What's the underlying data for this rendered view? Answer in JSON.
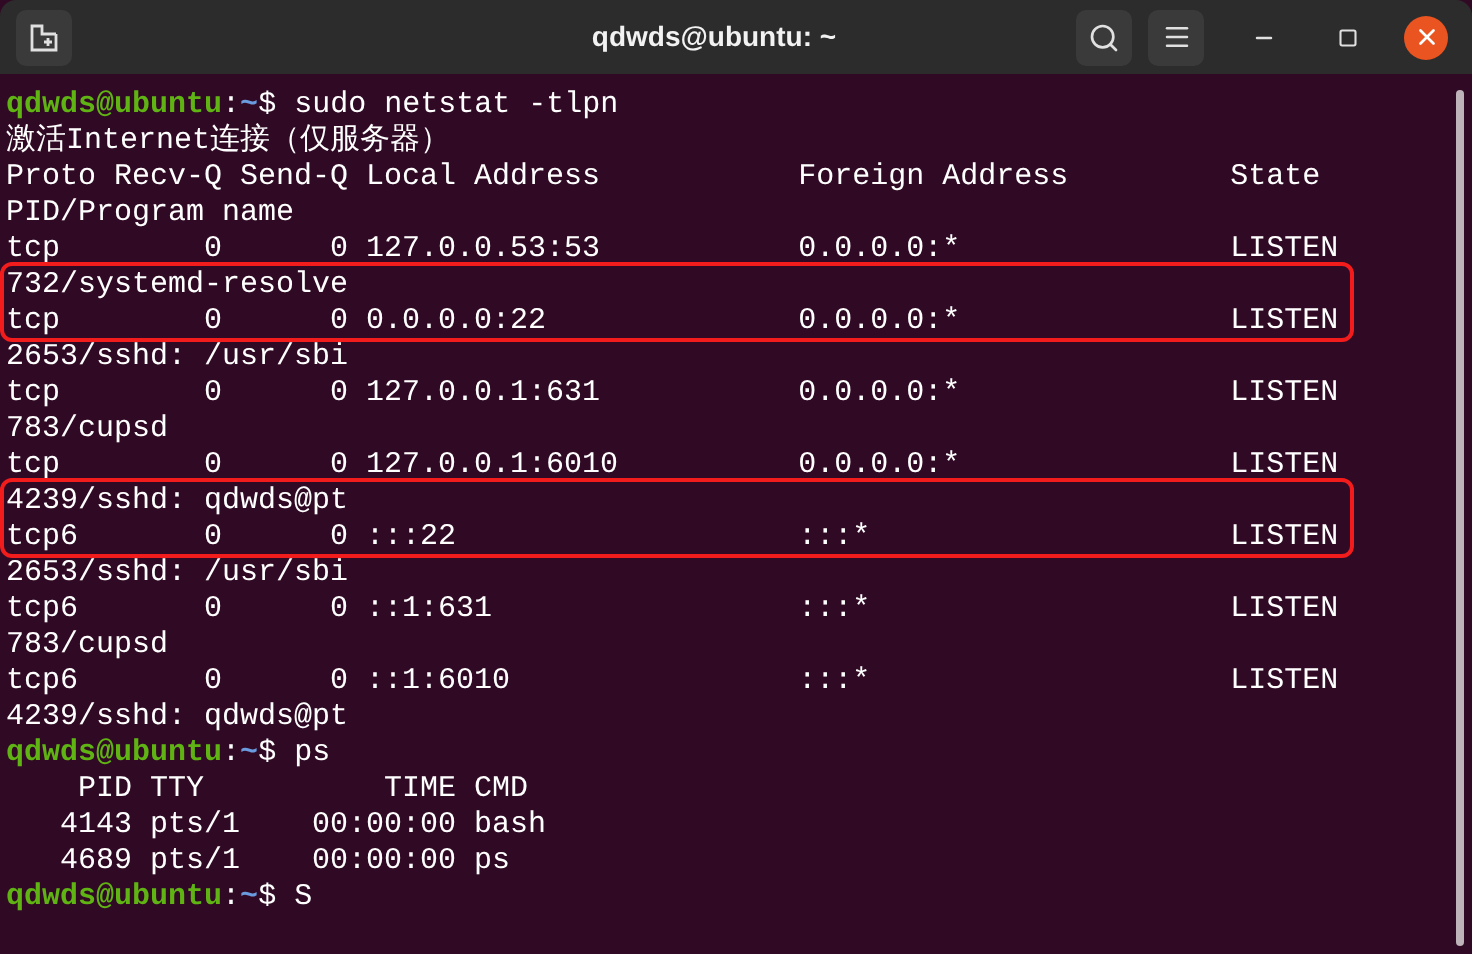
{
  "window": {
    "title": "qdwds@ubuntu: ~"
  },
  "terminal": {
    "lines": [
      {
        "kind": "prompt",
        "user": "qdwds@ubuntu",
        "sep": ":",
        "path": "~",
        "symbol": "$",
        "command": " sudo netstat -tlpn"
      },
      {
        "kind": "output",
        "text": "激活Internet连接（仅服务器）"
      },
      {
        "kind": "output",
        "text": "Proto Recv-Q Send-Q Local Address           Foreign Address         State"
      },
      {
        "kind": "output",
        "text": "PID/Program name"
      },
      {
        "kind": "output",
        "text": "tcp        0      0 127.0.0.53:53           0.0.0.0:*               LISTEN"
      },
      {
        "kind": "highlight",
        "lines": [
          {
            "kind": "output",
            "text": "732/systemd-resolve"
          },
          {
            "kind": "output",
            "text": "tcp        0      0 0.0.0.0:22              0.0.0.0:*               LISTEN"
          }
        ]
      },
      {
        "kind": "output",
        "text": "2653/sshd: /usr/sbi"
      },
      {
        "kind": "output",
        "text": "tcp        0      0 127.0.0.1:631           0.0.0.0:*               LISTEN"
      },
      {
        "kind": "output",
        "text": "783/cupsd"
      },
      {
        "kind": "output",
        "text": "tcp        0      0 127.0.0.1:6010          0.0.0.0:*               LISTEN"
      },
      {
        "kind": "highlight",
        "lines": [
          {
            "kind": "output",
            "text": "4239/sshd: qdwds@pt"
          },
          {
            "kind": "output",
            "text": "tcp6       0      0 :::22                   :::*                    LISTEN"
          }
        ]
      },
      {
        "kind": "output",
        "text": "2653/sshd: /usr/sbi"
      },
      {
        "kind": "output",
        "text": "tcp6       0      0 ::1:631                 :::*                    LISTEN"
      },
      {
        "kind": "output",
        "text": "783/cupsd"
      },
      {
        "kind": "output",
        "text": "tcp6       0      0 ::1:6010                :::*                    LISTEN"
      },
      {
        "kind": "output",
        "text": "4239/sshd: qdwds@pt"
      },
      {
        "kind": "prompt",
        "user": "qdwds@ubuntu",
        "sep": ":",
        "path": "~",
        "symbol": "$",
        "command": " ps"
      },
      {
        "kind": "output",
        "text": "    PID TTY          TIME CMD"
      },
      {
        "kind": "output",
        "text": "   4143 pts/1    00:00:00 bash"
      },
      {
        "kind": "output",
        "text": "   4689 pts/1    00:00:00 ps"
      },
      {
        "kind": "prompt",
        "user": "qdwds@ubuntu",
        "sep": ":",
        "path": "~",
        "symbol": "$",
        "command": " S"
      }
    ]
  }
}
